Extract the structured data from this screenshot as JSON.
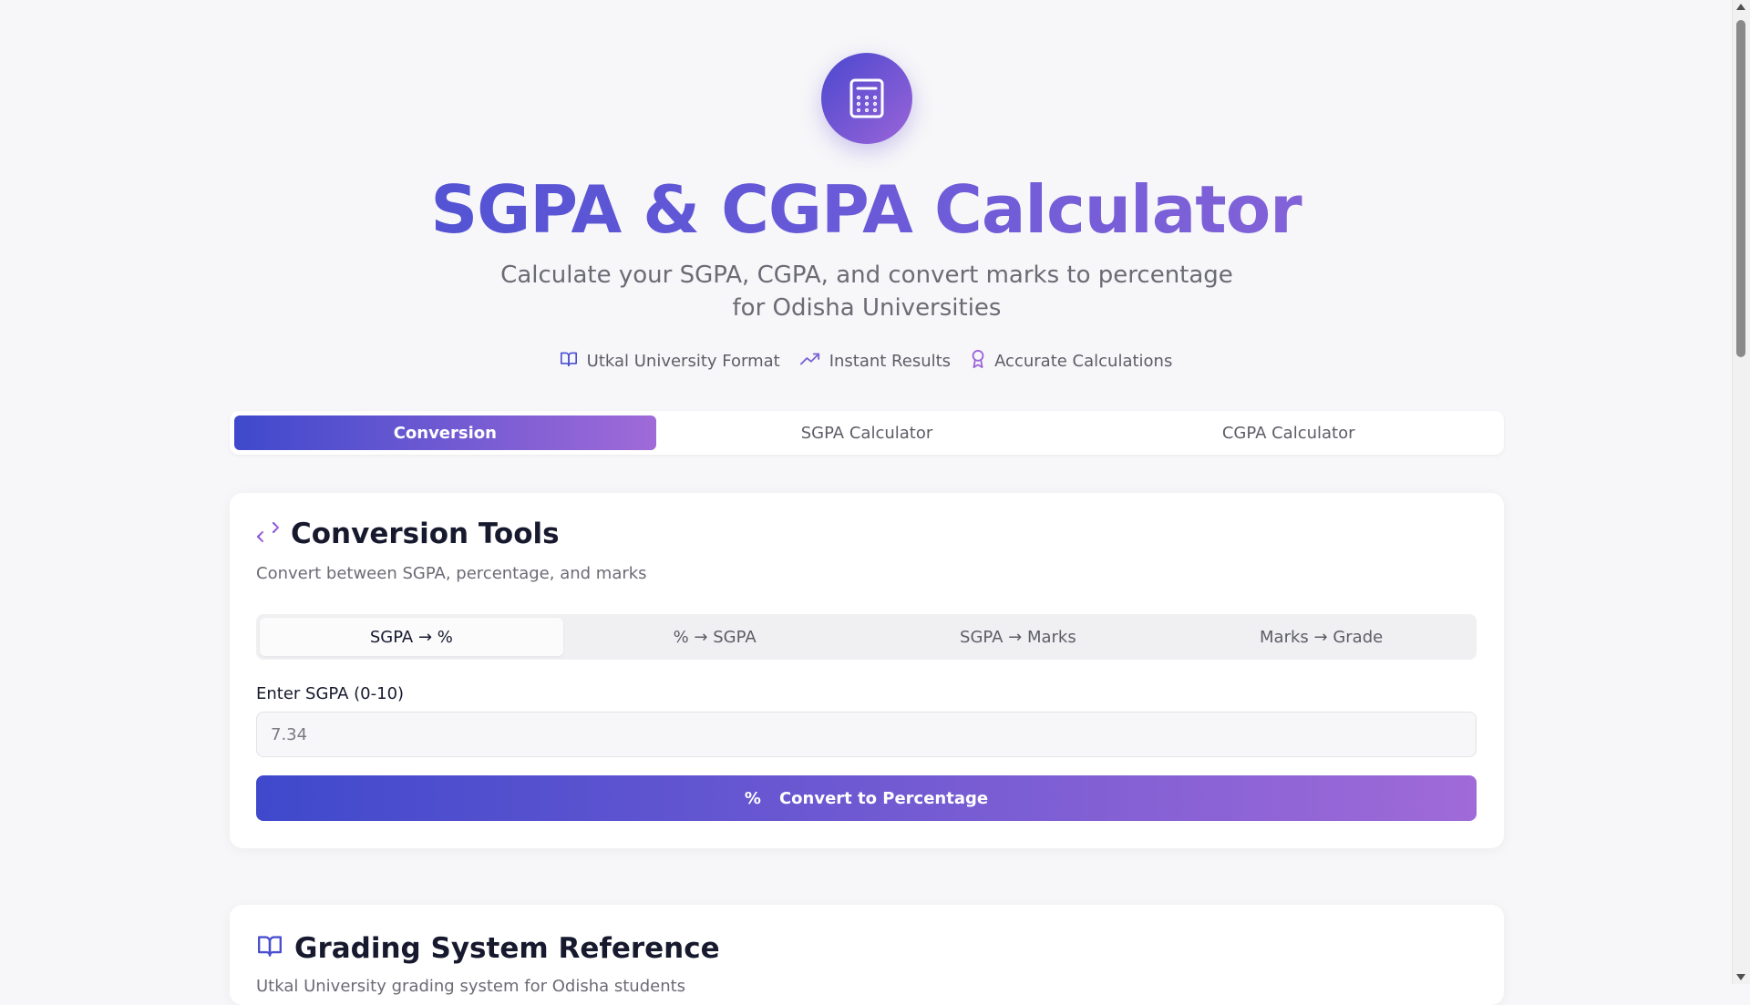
{
  "hero": {
    "title": "SGPA & CGPA Calculator",
    "subtitle": "Calculate your SGPA, CGPA, and convert marks to percentage for Odisha Universities",
    "icon": "calculator-icon",
    "badges": [
      {
        "icon": "book-open-icon",
        "label": "Utkal University Format"
      },
      {
        "icon": "trending-up-icon",
        "label": "Instant Results"
      },
      {
        "icon": "award-icon",
        "label": "Accurate Calculations"
      }
    ]
  },
  "main_tabs": [
    {
      "label": "Conversion",
      "active": true
    },
    {
      "label": "SGPA Calculator",
      "active": false
    },
    {
      "label": "CGPA Calculator",
      "active": false
    }
  ],
  "conversion": {
    "icon": "arrows-exchange-icon",
    "title": "Conversion Tools",
    "description": "Convert between SGPA, percentage, and marks",
    "sub_tabs": [
      {
        "label": "SGPA → %",
        "active": true
      },
      {
        "label": "% → SGPA",
        "active": false
      },
      {
        "label": "SGPA → Marks",
        "active": false
      },
      {
        "label": "Marks → Grade",
        "active": false
      }
    ],
    "input_label": "Enter SGPA (0-10)",
    "input_placeholder": "7.34",
    "button_icon": "percent-icon",
    "button_label": "Convert to Percentage"
  },
  "grading": {
    "icon": "book-open-icon",
    "title": "Grading System Reference",
    "description": "Utkal University grading system for Odisha students"
  },
  "colors": {
    "gradient_start": "#3f49cc",
    "gradient_end": "#a06ad8",
    "background": "#f7f7f9"
  }
}
